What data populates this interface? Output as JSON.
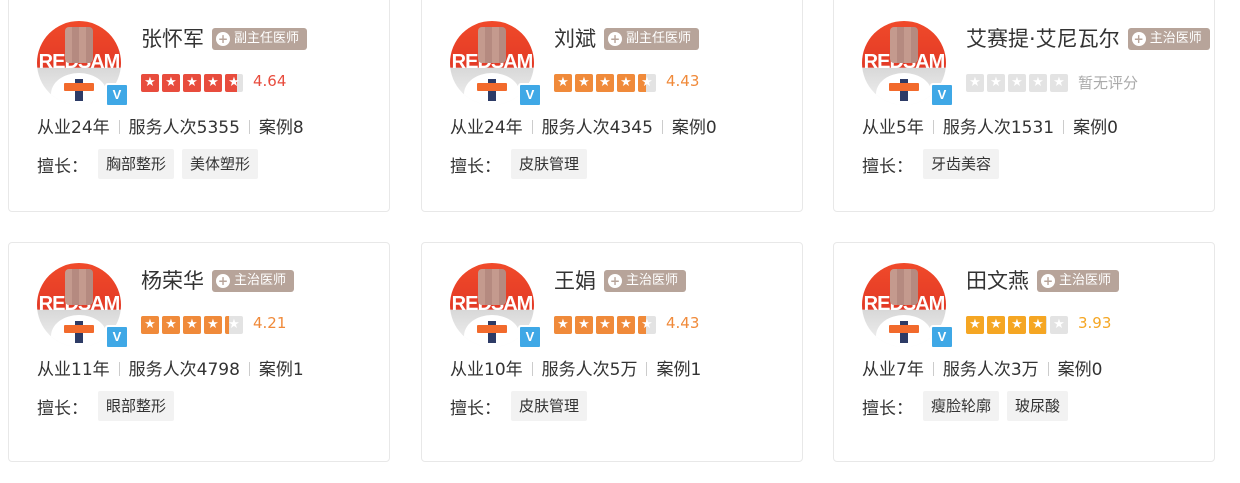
{
  "doctors": [
    {
      "name": "张怀军",
      "title": "副主任医师",
      "rating": 4.64,
      "rating_text": "4.64",
      "star_color": "#e84c3d",
      "score_color": "#e84c3d",
      "years": "从业24年",
      "served": "服务人次5355",
      "cases": "案例8",
      "skills_label": "擅长：",
      "skills": [
        "胸部整形",
        "美体塑形"
      ],
      "avatar_brand": "REDSAM"
    },
    {
      "name": "刘斌",
      "title": "副主任医师",
      "rating": 4.43,
      "rating_text": "4.43",
      "star_color": "#f08a3a",
      "score_color": "#f08a3a",
      "years": "从业24年",
      "served": "服务人次4345",
      "cases": "案例0",
      "skills_label": "擅长：",
      "skills": [
        "皮肤管理"
      ],
      "avatar_brand": "REDSAM"
    },
    {
      "name": "艾赛提·艾尼瓦尔",
      "title": "主治医师",
      "rating": 0,
      "rating_text": "暂无评分",
      "star_color": "#e3e3e3",
      "score_color": "#aaaaaa",
      "years": "从业5年",
      "served": "服务人次1531",
      "cases": "案例0",
      "skills_label": "擅长：",
      "skills": [
        "牙齿美容"
      ],
      "avatar_brand": "REDSAM"
    },
    {
      "name": "杨荣华",
      "title": "主治医师",
      "rating": 4.21,
      "rating_text": "4.21",
      "star_color": "#f08a3a",
      "score_color": "#f08a3a",
      "years": "从业11年",
      "served": "服务人次4798",
      "cases": "案例1",
      "skills_label": "擅长：",
      "skills": [
        "眼部整形"
      ],
      "avatar_brand": "REDSAM"
    },
    {
      "name": "王娟",
      "title": "主治医师",
      "rating": 4.43,
      "rating_text": "4.43",
      "star_color": "#f08a3a",
      "score_color": "#f08a3a",
      "years": "从业10年",
      "served": "服务人次5万",
      "cases": "案例1",
      "skills_label": "擅长：",
      "skills": [
        "皮肤管理"
      ],
      "avatar_brand": "REDSAM"
    },
    {
      "name": "田文燕",
      "title": "主治医师",
      "rating": 3.93,
      "rating_text": "3.93",
      "star_color": "#f5a623",
      "score_color": "#f5a623",
      "years": "从业7年",
      "served": "服务人次3万",
      "cases": "案例0",
      "skills_label": "擅长：",
      "skills": [
        "瘦脸轮廓",
        "玻尿酸"
      ],
      "avatar_brand": "REDSAM"
    }
  ]
}
